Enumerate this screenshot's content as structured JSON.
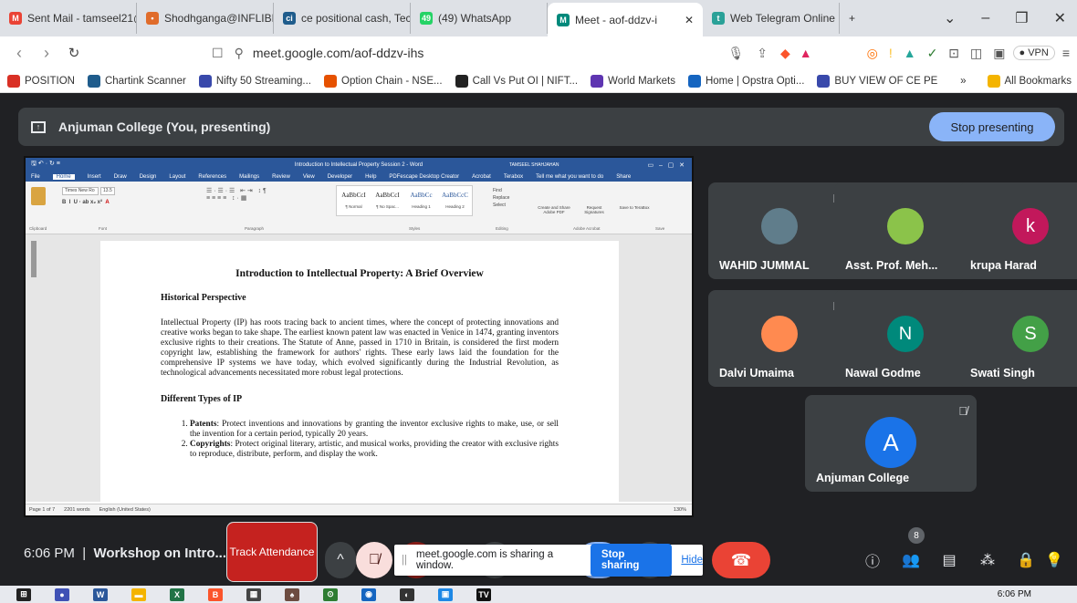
{
  "browser": {
    "tabs": [
      {
        "label": "Sent Mail - tamseel21@g",
        "fav": "M",
        "color": "#ea4335"
      },
      {
        "label": "Shodhganga@INFLIBNET",
        "fav": "•",
        "color": "#e06c2b"
      },
      {
        "label": "ce positional cash, Technic",
        "fav": "ci",
        "color": "#1f5c8c"
      },
      {
        "label": "(49) WhatsApp",
        "fav": "49",
        "color": "#25d366"
      },
      {
        "label": "Meet - aof-ddzv-i",
        "fav": "M",
        "color": "#00897b",
        "active": true
      },
      {
        "label": "Web Telegram Online (unc",
        "fav": "t",
        "color": "#2aa198"
      }
    ],
    "new_tab": "+",
    "url": "meet.google.com/aof-ddzv-ihs",
    "vpn": "VPN",
    "bookmarks": [
      {
        "label": "POSITION",
        "color": "#d93025"
      },
      {
        "label": "Chartink Scanner",
        "color": "#1f5c8c"
      },
      {
        "label": "Nifty 50 Streaming...",
        "color": "#3949ab"
      },
      {
        "label": "Option Chain - NSE...",
        "color": "#e65100"
      },
      {
        "label": "Call Vs Put OI | NIFT...",
        "color": "#222"
      },
      {
        "label": "World Markets",
        "color": "#5e35b1"
      },
      {
        "label": "Home | Opstra Opti...",
        "color": "#1565c0"
      },
      {
        "label": "BUY VIEW OF CE PE",
        "color": "#3949ab"
      }
    ],
    "all_bookmarks": "All Bookmarks"
  },
  "presenting": {
    "title": "Anjuman College (You, presenting)",
    "stop_label": "Stop presenting"
  },
  "word": {
    "title": "Introduction to Intellectual Property Session 2 - Word",
    "user": "TAMSEEL SHAHJAHAN",
    "menu": [
      "File",
      "Home",
      "Insert",
      "Draw",
      "Design",
      "Layout",
      "References",
      "Mailings",
      "Review",
      "View",
      "Developer",
      "Help",
      "PDFescape Desktop Creator",
      "Acrobat",
      "Terabox",
      "Tell me what you want to do",
      "Share"
    ],
    "font_name": "Times New Ro",
    "font_size": "13.5",
    "styles": [
      "AaBbCcI",
      "AaBbCcI",
      "AaBbCc",
      "AaBbCcC"
    ],
    "style_names": [
      "¶ Normal",
      "¶ No Spac...",
      "Heading 1",
      "Heading 2"
    ],
    "groups": [
      "Clipboard",
      "Font",
      "Paragraph",
      "Styles",
      "Editing",
      "Adobe Acrobat",
      "Save"
    ],
    "editing": [
      "Find",
      "Replace",
      "Select"
    ],
    "acrobat": [
      "Create and Share Adobe PDF",
      "Request Signatures",
      "Save to TeraBox"
    ],
    "status": [
      "Page 1 of 7",
      "2201 words",
      "English (United States)",
      "130%"
    ],
    "doc": {
      "h1": "Introduction to Intellectual Property: A Brief Overview",
      "h2a": "Historical Perspective",
      "p1": "Intellectual Property (IP) has roots tracing back to ancient times, where the concept of protecting innovations and creative works began to take shape. The earliest known patent law was enacted in Venice in 1474, granting inventors exclusive rights to their creations. The Statute of Anne, passed in 1710 in Britain, is considered the first modern copyright law, establishing the framework for authors' rights. These early laws laid the foundation for the comprehensive IP systems we have today, which evolved significantly during the Industrial Revolution, as technological advancements necessitated more robust legal protections.",
      "h2b": "Different Types of IP",
      "li1_b": "Patents",
      "li1": ": Protect inventions and innovations by granting the inventor exclusive rights to make, use, or sell the invention for a certain period, typically 20 years.",
      "li2_b": "Copyrights",
      "li2": ": Protect original literary, artistic, and musical works, providing the creator with exclusive rights to reproduce, distribute, perform, and display the work."
    }
  },
  "participants": [
    {
      "name": "WAHID JUMMAL",
      "initial": "",
      "color": "#607d8b"
    },
    {
      "name": "Asst. Prof. Meh...",
      "initial": "",
      "color": "#8bc34a"
    },
    {
      "name": "krupa Harad",
      "initial": "k",
      "color": "#c2185b"
    },
    {
      "name": "Dalvi Umaima",
      "initial": "",
      "color": "#ff8a50"
    },
    {
      "name": "Nawal Godme",
      "initial": "N",
      "color": "#00897b"
    },
    {
      "name": "Swati Singh",
      "initial": "S",
      "color": "#43a047"
    },
    {
      "name": "Anjuman College",
      "initial": "A",
      "color": "#1a73e8"
    }
  ],
  "meeting": {
    "time": "6:06 PM",
    "separator": "|",
    "name": "Workshop on Intro...",
    "track": "Track Attendance",
    "sharing_text": "meet.google.com is sharing a window.",
    "stop_sharing": "Stop sharing",
    "hide": "Hide",
    "people_count": "8"
  },
  "taskbar": {
    "time": "6:06 PM"
  }
}
